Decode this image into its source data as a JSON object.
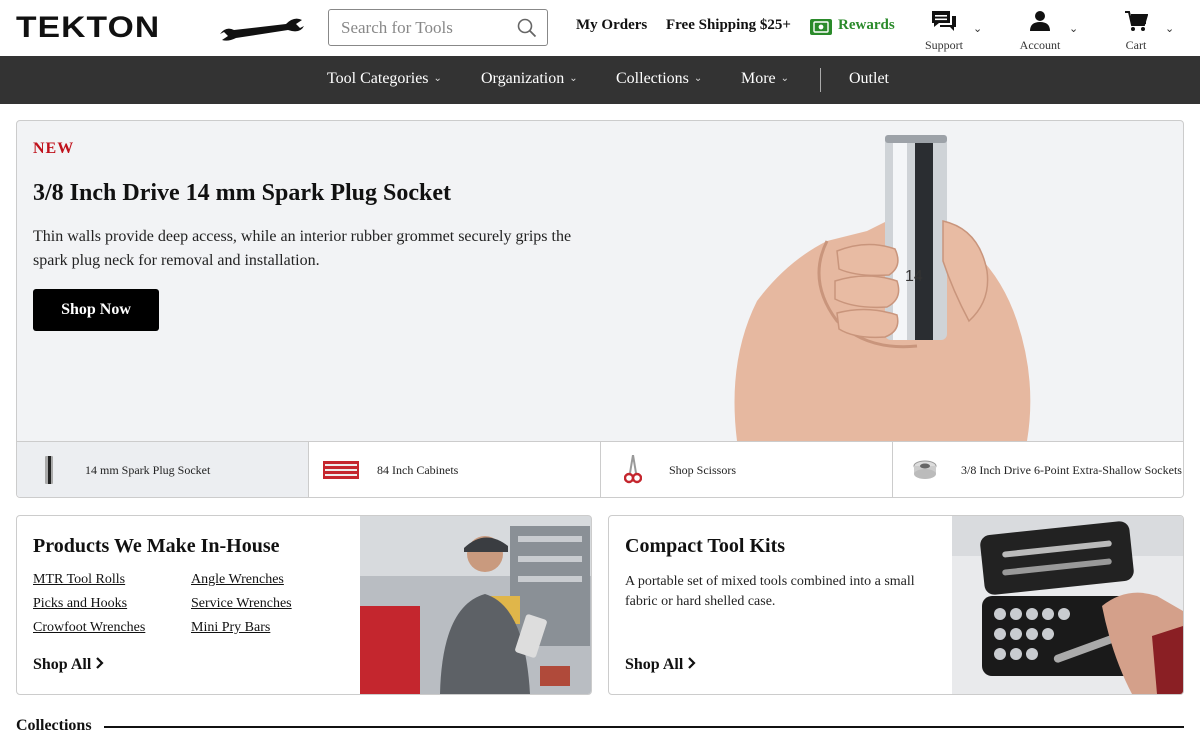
{
  "header": {
    "logo_text": "TEKTON",
    "search_placeholder": "Search for Tools",
    "my_orders": "My Orders",
    "free_shipping": "Free Shipping $25+",
    "rewards": "Rewards",
    "support": "Support",
    "account": "Account",
    "cart": "Cart",
    "rewards_color": "#2a8a2a"
  },
  "nav": {
    "items": [
      "Tool Categories",
      "Organization",
      "Collections",
      "More"
    ],
    "outlet": "Outlet"
  },
  "hero": {
    "badge": "NEW",
    "title": "3/8 Inch Drive 14 mm Spark Plug Socket",
    "description": "Thin walls provide deep access, while an interior rubber grommet securely grips the spark plug neck for removal and installation.",
    "button": "Shop Now",
    "socket_marking": "14",
    "thumbs": [
      {
        "label": "14 mm Spark Plug Socket",
        "icon": "socket-thumb-icon"
      },
      {
        "label": "84 Inch Cabinets",
        "icon": "cabinet-thumb-icon"
      },
      {
        "label": "Shop Scissors",
        "icon": "scissors-thumb-icon"
      },
      {
        "label": "3/8 Inch Drive 6-Point Extra-Shallow Sockets",
        "icon": "shallow-socket-thumb-icon"
      }
    ],
    "accent_color": "#c0121c"
  },
  "cards": {
    "inhouse": {
      "title": "Products We Make In-House",
      "links": [
        "MTR Tool Rolls",
        "Angle Wrenches",
        "Picks and Hooks",
        "Service Wrenches",
        "Crowfoot Wrenches",
        "Mini Pry Bars"
      ],
      "shop_all": "Shop All"
    },
    "kits": {
      "title": "Compact Tool Kits",
      "description": "A portable set of mixed tools combined into a small fabric or hard shelled case.",
      "shop_all": "Shop All"
    }
  },
  "collections": {
    "title": "Collections"
  }
}
